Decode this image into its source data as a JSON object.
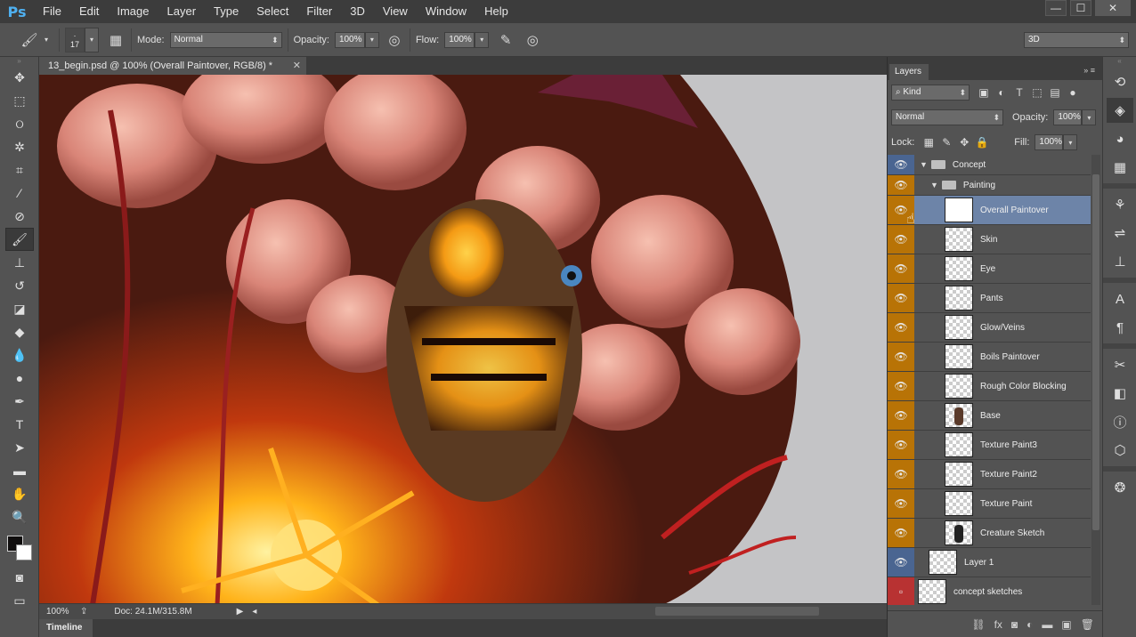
{
  "app": {
    "logo": "Ps"
  },
  "menu": [
    "File",
    "Edit",
    "Image",
    "Layer",
    "Type",
    "Select",
    "Filter",
    "3D",
    "View",
    "Window",
    "Help"
  ],
  "window_controls": {
    "minimize": "—",
    "maximize": "☐",
    "close": "✕"
  },
  "options": {
    "brush_size": "17",
    "mode_label": "Mode:",
    "mode_value": "Normal",
    "opacity_label": "Opacity:",
    "opacity_value": "100%",
    "flow_label": "Flow:",
    "flow_value": "100%",
    "workspace": "3D"
  },
  "document": {
    "tab_title": "13_begin.psd @ 100% (Overall Paintover, RGB/8) *",
    "zoom": "100%",
    "doc_info": "Doc: 24.1M/315.8M"
  },
  "timeline_label": "Timeline",
  "layers_panel": {
    "tab": "Layers",
    "filter_kind": "Kind",
    "blend_mode": "Normal",
    "opacity_label": "Opacity:",
    "opacity_value": "100%",
    "lock_label": "Lock:",
    "fill_label": "Fill:",
    "fill_value": "100%",
    "groups": {
      "concept": "Concept",
      "painting": "Painting"
    },
    "layers": [
      {
        "name": "Overall Paintover",
        "selected": true
      },
      {
        "name": "Skin"
      },
      {
        "name": "Eye"
      },
      {
        "name": "Pants"
      },
      {
        "name": "Glow/Veins"
      },
      {
        "name": "Boils Paintover"
      },
      {
        "name": "Rough Color Blocking"
      },
      {
        "name": "Base"
      },
      {
        "name": "Texture Paint3"
      },
      {
        "name": "Texture Paint2"
      },
      {
        "name": "Texture Paint"
      },
      {
        "name": "Creature Sketch"
      }
    ],
    "layer1": "Layer 1",
    "concept_sketches": "concept sketches"
  },
  "colors": {
    "foreground": "#100e0e",
    "background": "#ffffff",
    "visibility_orange": "#b87306",
    "visibility_blue": "#4a6591",
    "selection": "#6d84a8"
  }
}
